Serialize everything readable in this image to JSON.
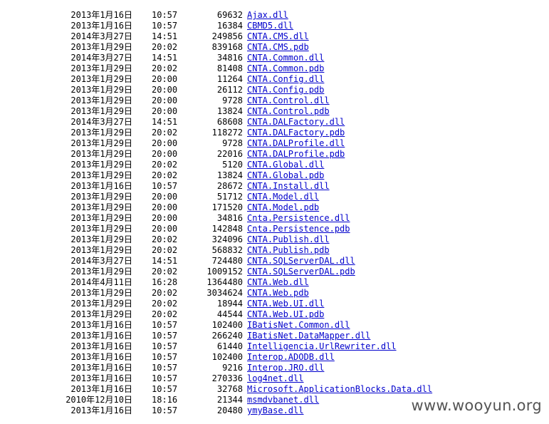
{
  "files": [
    {
      "date": "2013年1月16日",
      "time": "10:57",
      "size": "69632",
      "name": "Ajax.dll"
    },
    {
      "date": "2013年1月16日",
      "time": "10:57",
      "size": "16384",
      "name": "CBMD5.dll"
    },
    {
      "date": "2014年3月27日",
      "time": "14:51",
      "size": "249856",
      "name": "CNTA.CMS.dll"
    },
    {
      "date": "2013年1月29日",
      "time": "20:02",
      "size": "839168",
      "name": "CNTA.CMS.pdb"
    },
    {
      "date": "2014年3月27日",
      "time": "14:51",
      "size": "34816",
      "name": "CNTA.Common.dll"
    },
    {
      "date": "2013年1月29日",
      "time": "20:02",
      "size": "81408",
      "name": "CNTA.Common.pdb"
    },
    {
      "date": "2013年1月29日",
      "time": "20:00",
      "size": "11264",
      "name": "CNTA.Config.dll"
    },
    {
      "date": "2013年1月29日",
      "time": "20:00",
      "size": "26112",
      "name": "CNTA.Config.pdb"
    },
    {
      "date": "2013年1月29日",
      "time": "20:00",
      "size": "9728",
      "name": "CNTA.Control.dll"
    },
    {
      "date": "2013年1月29日",
      "time": "20:00",
      "size": "13824",
      "name": "CNTA.Control.pdb"
    },
    {
      "date": "2014年3月27日",
      "time": "14:51",
      "size": "68608",
      "name": "CNTA.DALFactory.dll"
    },
    {
      "date": "2013年1月29日",
      "time": "20:02",
      "size": "118272",
      "name": "CNTA.DALFactory.pdb"
    },
    {
      "date": "2013年1月29日",
      "time": "20:00",
      "size": "9728",
      "name": "CNTA.DALProfile.dll"
    },
    {
      "date": "2013年1月29日",
      "time": "20:00",
      "size": "22016",
      "name": "CNTA.DALProfile.pdb"
    },
    {
      "date": "2013年1月29日",
      "time": "20:02",
      "size": "5120",
      "name": "CNTA.Global.dll"
    },
    {
      "date": "2013年1月29日",
      "time": "20:02",
      "size": "13824",
      "name": "CNTA.Global.pdb"
    },
    {
      "date": "2013年1月16日",
      "time": "10:57",
      "size": "28672",
      "name": "CNTA.Install.dll"
    },
    {
      "date": "2013年1月29日",
      "time": "20:00",
      "size": "51712",
      "name": "CNTA.Model.dll"
    },
    {
      "date": "2013年1月29日",
      "time": "20:00",
      "size": "171520",
      "name": "CNTA.Model.pdb"
    },
    {
      "date": "2013年1月29日",
      "time": "20:00",
      "size": "34816",
      "name": "Cnta.Persistence.dll"
    },
    {
      "date": "2013年1月29日",
      "time": "20:00",
      "size": "142848",
      "name": "Cnta.Persistence.pdb"
    },
    {
      "date": "2013年1月29日",
      "time": "20:02",
      "size": "324096",
      "name": "CNTA.Publish.dll"
    },
    {
      "date": "2013年1月29日",
      "time": "20:02",
      "size": "568832",
      "name": "CNTA.Publish.pdb"
    },
    {
      "date": "2014年3月27日",
      "time": "14:51",
      "size": "724480",
      "name": "CNTA.SQLServerDAL.dll"
    },
    {
      "date": "2013年1月29日",
      "time": "20:02",
      "size": "1009152",
      "name": "CNTA.SQLServerDAL.pdb"
    },
    {
      "date": "2014年4月11日",
      "time": "16:28",
      "size": "1364480",
      "name": "CNTA.Web.dll"
    },
    {
      "date": "2013年1月29日",
      "time": "20:02",
      "size": "3034624",
      "name": "CNTA.Web.pdb"
    },
    {
      "date": "2013年1月29日",
      "time": "20:02",
      "size": "18944",
      "name": "CNTA.Web.UI.dll"
    },
    {
      "date": "2013年1月29日",
      "time": "20:02",
      "size": "44544",
      "name": "CNTA.Web.UI.pdb"
    },
    {
      "date": "2013年1月16日",
      "time": "10:57",
      "size": "102400",
      "name": "IBatisNet.Common.dll"
    },
    {
      "date": "2013年1月16日",
      "time": "10:57",
      "size": "266240",
      "name": "IBatisNet.DataMapper.dll"
    },
    {
      "date": "2013年1月16日",
      "time": "10:57",
      "size": "61440",
      "name": "Intelligencia.UrlRewriter.dll"
    },
    {
      "date": "2013年1月16日",
      "time": "10:57",
      "size": "102400",
      "name": "Interop.ADODB.dll"
    },
    {
      "date": "2013年1月16日",
      "time": "10:57",
      "size": "9216",
      "name": "Interop.JRO.dll"
    },
    {
      "date": "2013年1月16日",
      "time": "10:57",
      "size": "270336",
      "name": "log4net.dll"
    },
    {
      "date": "2013年1月16日",
      "time": "10:57",
      "size": "32768",
      "name": "Microsoft.ApplicationBlocks.Data.dll"
    },
    {
      "date": "2010年12月10日",
      "time": "18:16",
      "size": "21344",
      "name": "msmdvbanet.dll"
    },
    {
      "date": "2013年1月16日",
      "time": "10:57",
      "size": "20480",
      "name": "ymyBase.dll"
    }
  ],
  "watermark": "www.wooyun.org"
}
